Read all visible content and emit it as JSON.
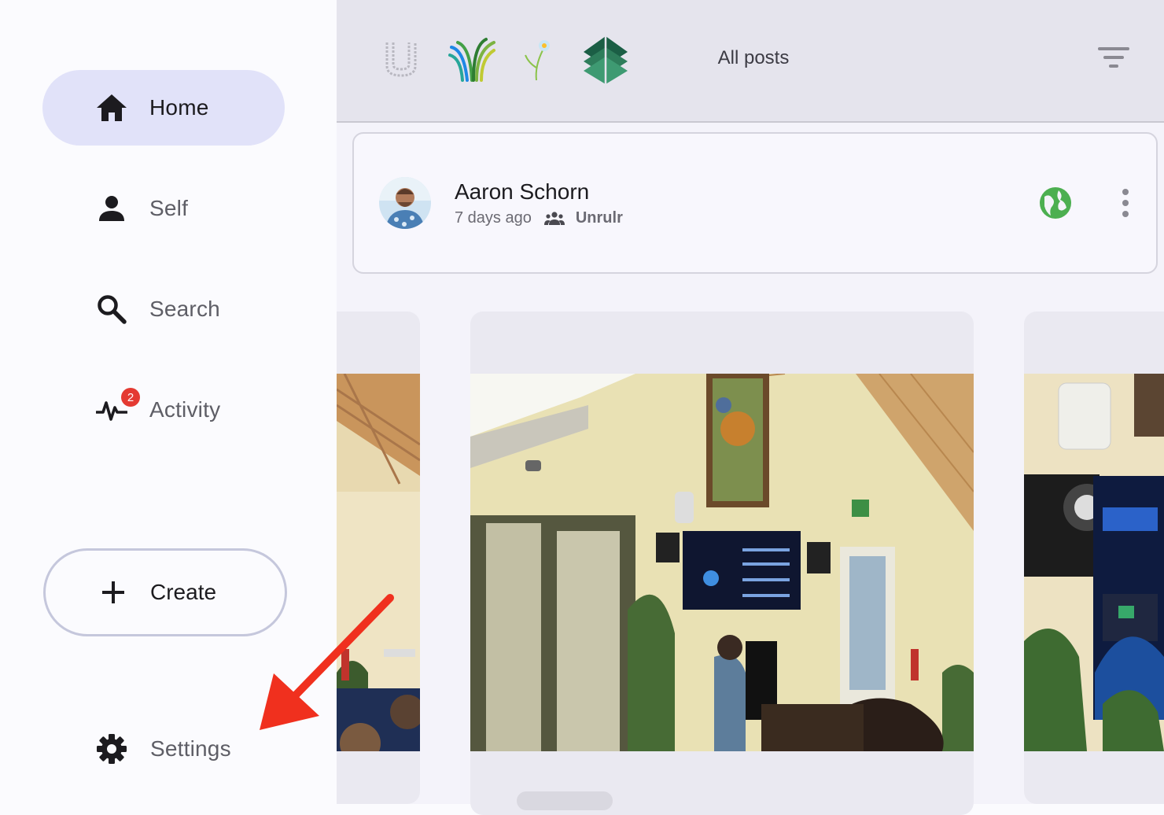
{
  "sidebar": {
    "items": [
      {
        "label": "Home",
        "icon": "home-icon",
        "active": true
      },
      {
        "label": "Self",
        "icon": "person-icon",
        "active": false
      },
      {
        "label": "Search",
        "icon": "search-icon",
        "active": false
      },
      {
        "label": "Activity",
        "icon": "activity-icon",
        "active": false,
        "badge": "2"
      }
    ],
    "create_label": "Create",
    "settings_label": "Settings"
  },
  "topbar": {
    "apps": [
      "unrulr-app-icon",
      "waves-app-icon",
      "flower-app-icon",
      "leaf-stack-app-icon"
    ],
    "feed_selector": "All posts",
    "filter_icon": "filter-icon"
  },
  "post": {
    "author": "Aaron Schorn",
    "time": "7 days ago",
    "group": "Unrulr",
    "visibility_icon": "globe-icon",
    "menu_icon": "more-vert-icon"
  },
  "colors": {
    "active_nav": "#e1e2f9",
    "badge": "#e43a32",
    "globe": "#4caf50",
    "annotation_arrow": "#f0301e"
  }
}
